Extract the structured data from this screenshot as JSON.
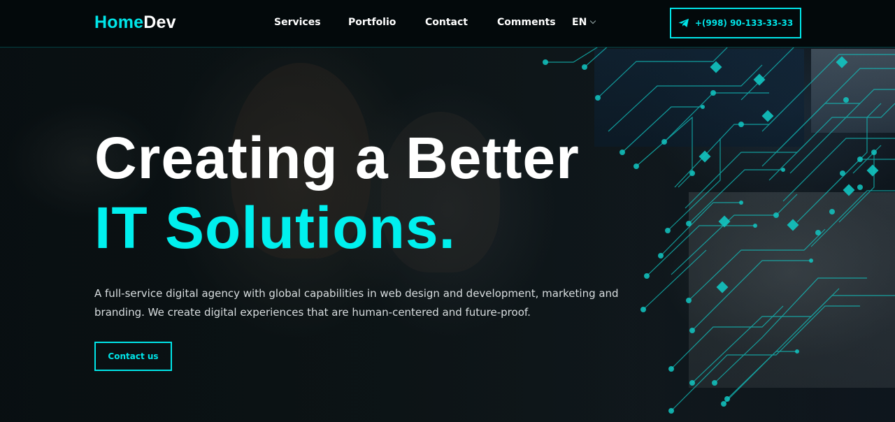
{
  "brand": {
    "part1": "Home",
    "part2": "Dev",
    "accent": "#00e5e8"
  },
  "nav": {
    "items": [
      "Services",
      "Portfolio",
      "Contact",
      "Comments"
    ],
    "language": "EN"
  },
  "header": {
    "phone": "+(998) 90-133-33-33",
    "phone_icon": "telegram-icon"
  },
  "hero": {
    "title_line1": "Creating a Better",
    "title_line2": "IT Solutions.",
    "description": "A full-service digital agency with global capabilities in web design and development, marketing and branding. We create digital experiences that are human-centered and future-proof.",
    "cta": "Contact us"
  },
  "colors": {
    "background": "#0b1114",
    "header": "#03090b",
    "accent": "#00e5e8",
    "title_accent": "#00f0ee"
  }
}
